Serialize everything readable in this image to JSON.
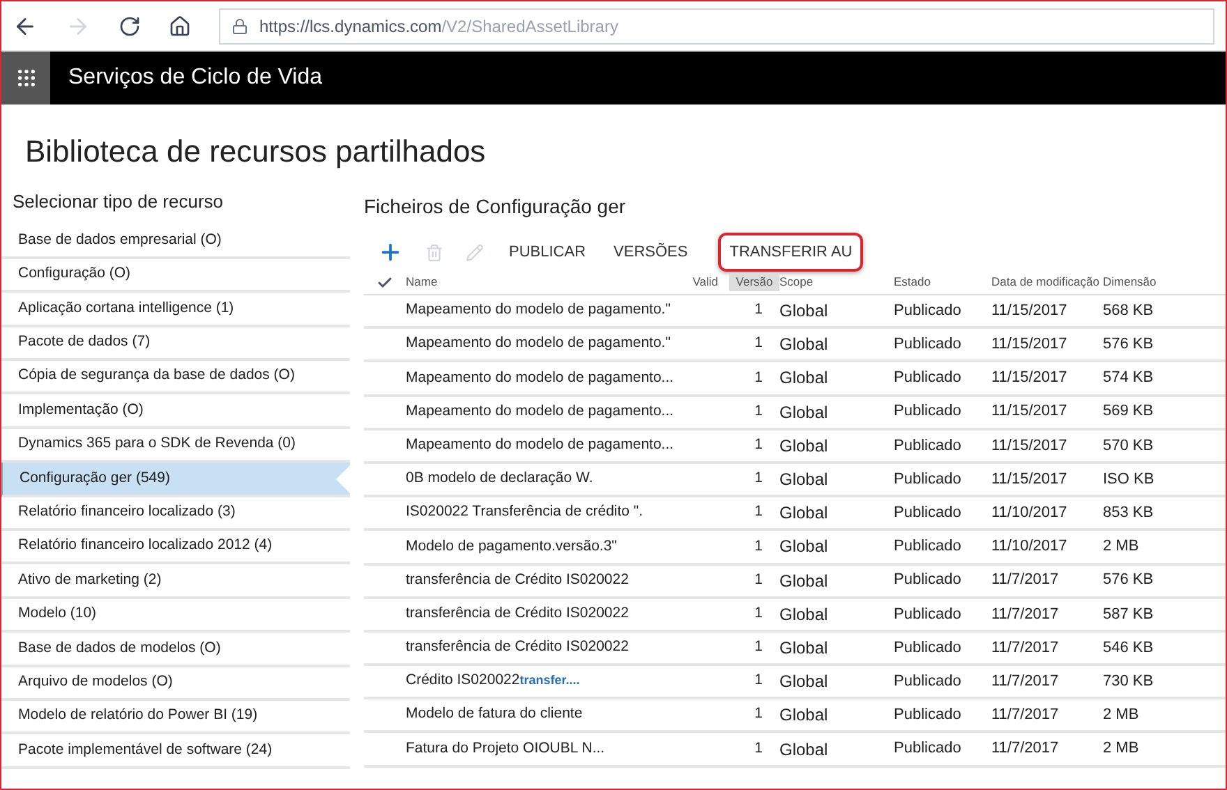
{
  "browser": {
    "url_host": "https://lcs.dynamics.com",
    "url_path": "/V2/SharedAssetLibrary"
  },
  "app_bar": {
    "title": "Serviços de Ciclo de Vida"
  },
  "page_title": "Biblioteca de recursos partilhados",
  "sidebar": {
    "heading": "Selecionar tipo de recurso",
    "items": [
      {
        "label": "Base de dados empresarial (O)",
        "selected": false
      },
      {
        "label": "Configuração (O)",
        "selected": false
      },
      {
        "label": "Aplicação cortana intelligence (1)",
        "selected": false
      },
      {
        "label": "Pacote de dados (7)",
        "selected": false
      },
      {
        "label": "Cópia de segurança da base de dados (O)",
        "selected": false
      },
      {
        "label": "Implementação (O)",
        "selected": false
      },
      {
        "label": "Dynamics 365 para o SDK de Revenda (0)",
        "selected": false
      },
      {
        "label": "Configuração ger (549)",
        "selected": true
      },
      {
        "label": "Relatório financeiro localizado (3)",
        "selected": false
      },
      {
        "label": "Relatório financeiro localizado 2012 (4)",
        "selected": false
      },
      {
        "label": "Ativo de marketing (2)",
        "selected": false
      },
      {
        "label": "Modelo (10)",
        "selected": false
      },
      {
        "label": "Base de dados de modelos (O)",
        "selected": false
      },
      {
        "label": "Arquivo de modelos (O)",
        "selected": false
      },
      {
        "label": "Modelo de relatório do Power BI (19)",
        "selected": false
      },
      {
        "label": "Pacote implementável de software (24)",
        "selected": false
      }
    ]
  },
  "files": {
    "heading": "Ficheiros de Configuração ger",
    "toolbar": [
      {
        "kind": "add",
        "disabled": false
      },
      {
        "kind": "delete",
        "disabled": true
      },
      {
        "kind": "edit",
        "disabled": true
      },
      {
        "kind": "text",
        "label": "PUBLICAR",
        "highlighted": false
      },
      {
        "kind": "text",
        "label": "VERSÕES",
        "highlighted": false
      },
      {
        "kind": "text",
        "label": "TRANSFERIR AU",
        "highlighted": true
      }
    ],
    "columns": [
      {
        "label": "Name",
        "sorted": false
      },
      {
        "label": "Valid",
        "sorted": false
      },
      {
        "label": "Versão",
        "sorted": true
      },
      {
        "label": "Scope",
        "sorted": false
      },
      {
        "label": "Estado",
        "sorted": false
      },
      {
        "label": "Data de modificação",
        "sorted": false
      },
      {
        "label": "Dimensão",
        "sorted": false
      }
    ],
    "rows": [
      {
        "name": "Mapeamento do modelo de pagamento.\"",
        "version": "1",
        "scope": "Global",
        "state": "Publicado",
        "date": "11/15/2017",
        "size": "568 KB"
      },
      {
        "name": "Mapeamento do modelo de pagamento.\"",
        "version": "1",
        "scope": "Global",
        "state": "Publicado",
        "date": "11/15/2017",
        "size": "576 KB"
      },
      {
        "name": "Mapeamento do modelo de pagamento...",
        "version": "1",
        "scope": "Global",
        "state": "Publicado",
        "date": "11/15/2017",
        "size": "574 KB"
      },
      {
        "name": "Mapeamento do modelo de pagamento...",
        "version": "1",
        "scope": "Global",
        "state": "Publicado",
        "date": "11/15/2017",
        "size": "569 KB"
      },
      {
        "name": "Mapeamento do modelo de pagamento...",
        "version": "1",
        "scope": "Global",
        "state": "Publicado",
        "date": "11/15/2017",
        "size": "570 KB"
      },
      {
        "name": "0B modelo de declaração W.",
        "version": "1",
        "scope": "Global",
        "state": "Publicado",
        "date": "11/15/2017",
        "size": "ISO KB"
      },
      {
        "name": "IS020022 Transferência de crédito \".",
        "version": "1",
        "scope": "Global",
        "state": "Publicado",
        "date": "11/10/2017",
        "size": "853 KB"
      },
      {
        "name": "Modelo de pagamento.versão.3\"",
        "version": "1",
        "scope": "Global",
        "state": "Publicado",
        "date": "11/10/2017",
        "size": "2 MB"
      },
      {
        "name": "transferência de Crédito IS020022",
        "version": "1",
        "scope": "Global",
        "state": "Publicado",
        "date": "11/7/2017",
        "size": "576 KB"
      },
      {
        "name": "transferência de Crédito IS020022",
        "version": "1",
        "scope": "Global",
        "state": "Publicado",
        "date": "11/7/2017",
        "size": "587 KB"
      },
      {
        "name": "transferência de Crédito IS020022",
        "version": "1",
        "scope": "Global",
        "state": "Publicado",
        "date": "11/7/2017",
        "size": "546 KB"
      },
      {
        "name": "Crédito IS020022",
        "link": "transfer....",
        "version": "1",
        "scope": "Global",
        "state": "Publicado",
        "date": "11/7/2017",
        "size": "730 KB"
      },
      {
        "name": "Modelo de fatura do cliente",
        "version": "1",
        "scope": "Global",
        "state": "Publicado",
        "date": "11/7/2017",
        "size": "2 MB"
      },
      {
        "name": "Fatura do Projeto OIOUBL N...",
        "version": "1",
        "scope": "Global",
        "state": "Publicado",
        "date": "11/7/2017",
        "size": "2 MB"
      }
    ]
  }
}
